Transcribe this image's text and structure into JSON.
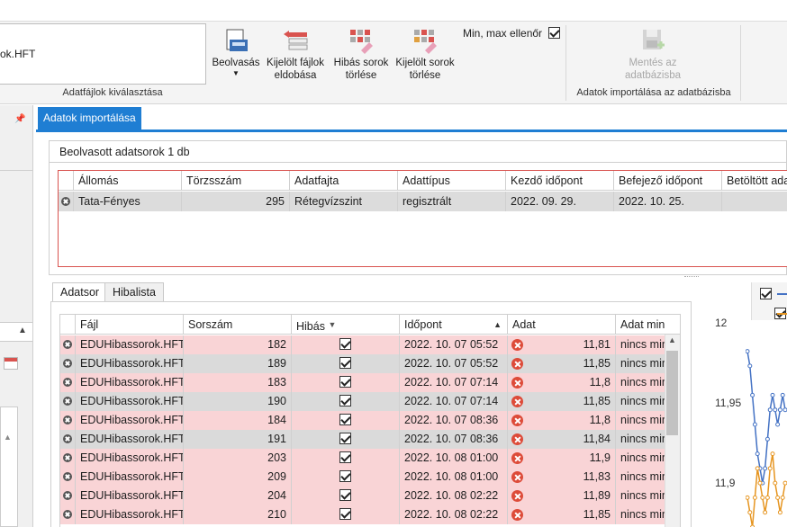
{
  "ribbon": {
    "file_box_text": "ok.HFT",
    "group_file_label": "Adatfájlok kiválasztása",
    "buttons": {
      "read": "Beolvasás",
      "discard": "Kijelölt fájlok eldobása",
      "delete_error_rows": "Hibás sorok törlése",
      "delete_selected_rows": "Kijelölt sorok törlése",
      "save": "Mentés az adatbázisba"
    },
    "minmax_check_label": "Min, max ellenőr",
    "group_import_label": "Adatok importálása az adatbázisba"
  },
  "doc_tab": {
    "label": "Adatok importálása"
  },
  "upper": {
    "title": "Beolvasott adatsorok 1 db",
    "columns": [
      "Állomás",
      "Törzsszám",
      "Adatfajta",
      "Adattípus",
      "Kezdő időpont",
      "Befejező időpont",
      "Betöltött ada"
    ],
    "row": [
      "Tata-Fényes",
      "295",
      "Rétegvízszint",
      "regisztrált",
      "2022. 09. 29.",
      "2022. 10. 25.",
      ""
    ]
  },
  "lower_tabs": [
    "Adatsor",
    "Hibalista"
  ],
  "lower": {
    "columns": [
      "Fájl",
      "Sorszám",
      "Hibás",
      "Időpont",
      "Adat",
      "Adat min"
    ],
    "rows": [
      {
        "file": "EDUHibassorok.HFT",
        "num": "182",
        "time": "2022. 10. 07 05:52",
        "value": "11,81",
        "note": "nincs min",
        "shade": "pink"
      },
      {
        "file": "EDUHibassorok.HFT",
        "num": "189",
        "time": "2022. 10. 07 05:52",
        "value": "11,85",
        "note": "nincs min",
        "shade": "grey"
      },
      {
        "file": "EDUHibassorok.HFT",
        "num": "183",
        "time": "2022. 10. 07 07:14",
        "value": "11,8",
        "note": "nincs min",
        "shade": "pink"
      },
      {
        "file": "EDUHibassorok.HFT",
        "num": "190",
        "time": "2022. 10. 07 07:14",
        "value": "11,85",
        "note": "nincs min",
        "shade": "grey"
      },
      {
        "file": "EDUHibassorok.HFT",
        "num": "184",
        "time": "2022. 10. 07 08:36",
        "value": "11,8",
        "note": "nincs min",
        "shade": "pink"
      },
      {
        "file": "EDUHibassorok.HFT",
        "num": "191",
        "time": "2022. 10. 07 08:36",
        "value": "11,84",
        "note": "nincs min",
        "shade": "grey"
      },
      {
        "file": "EDUHibassorok.HFT",
        "num": "203",
        "time": "2022. 10. 08 01:00",
        "value": "11,9",
        "note": "nincs min",
        "shade": "pink"
      },
      {
        "file": "EDUHibassorok.HFT",
        "num": "209",
        "time": "2022. 10. 08 01:00",
        "value": "11,83",
        "note": "nincs min",
        "shade": "pink"
      },
      {
        "file": "EDUHibassorok.HFT",
        "num": "204",
        "time": "2022. 10. 08 02:22",
        "value": "11,89",
        "note": "nincs min",
        "shade": "pink"
      },
      {
        "file": "EDUHibassorok.HFT",
        "num": "210",
        "time": "2022. 10. 08 02:22",
        "value": "11,85",
        "note": "nincs min",
        "shade": "pink"
      }
    ]
  },
  "chart": {
    "y_ticks": [
      "12",
      "11,95",
      "11,9"
    ]
  },
  "chart_data": {
    "type": "line",
    "y_ticks": [
      "12",
      "11,95",
      "11,9"
    ],
    "ylim": [
      11.88,
      12.02
    ],
    "series": [
      {
        "color": "#4472c4",
        "values": [
          12.0,
          11.99,
          11.97,
          11.95,
          11.93,
          11.92,
          11.91,
          11.92,
          11.94,
          11.96,
          11.97,
          11.96,
          11.95,
          11.96,
          11.97,
          11.96
        ]
      },
      {
        "color": "#e69520",
        "values": [
          11.9,
          11.89,
          11.88,
          11.9,
          11.92,
          11.91,
          11.9,
          11.89,
          11.9,
          11.92,
          11.93,
          11.91,
          11.9,
          11.89,
          11.9,
          11.91
        ]
      }
    ]
  },
  "colors": {
    "accent": "#1f7ed3",
    "error_row": "#f9d4d6",
    "error_icon": "#dd4b39",
    "upper_border": "#d9534f"
  }
}
